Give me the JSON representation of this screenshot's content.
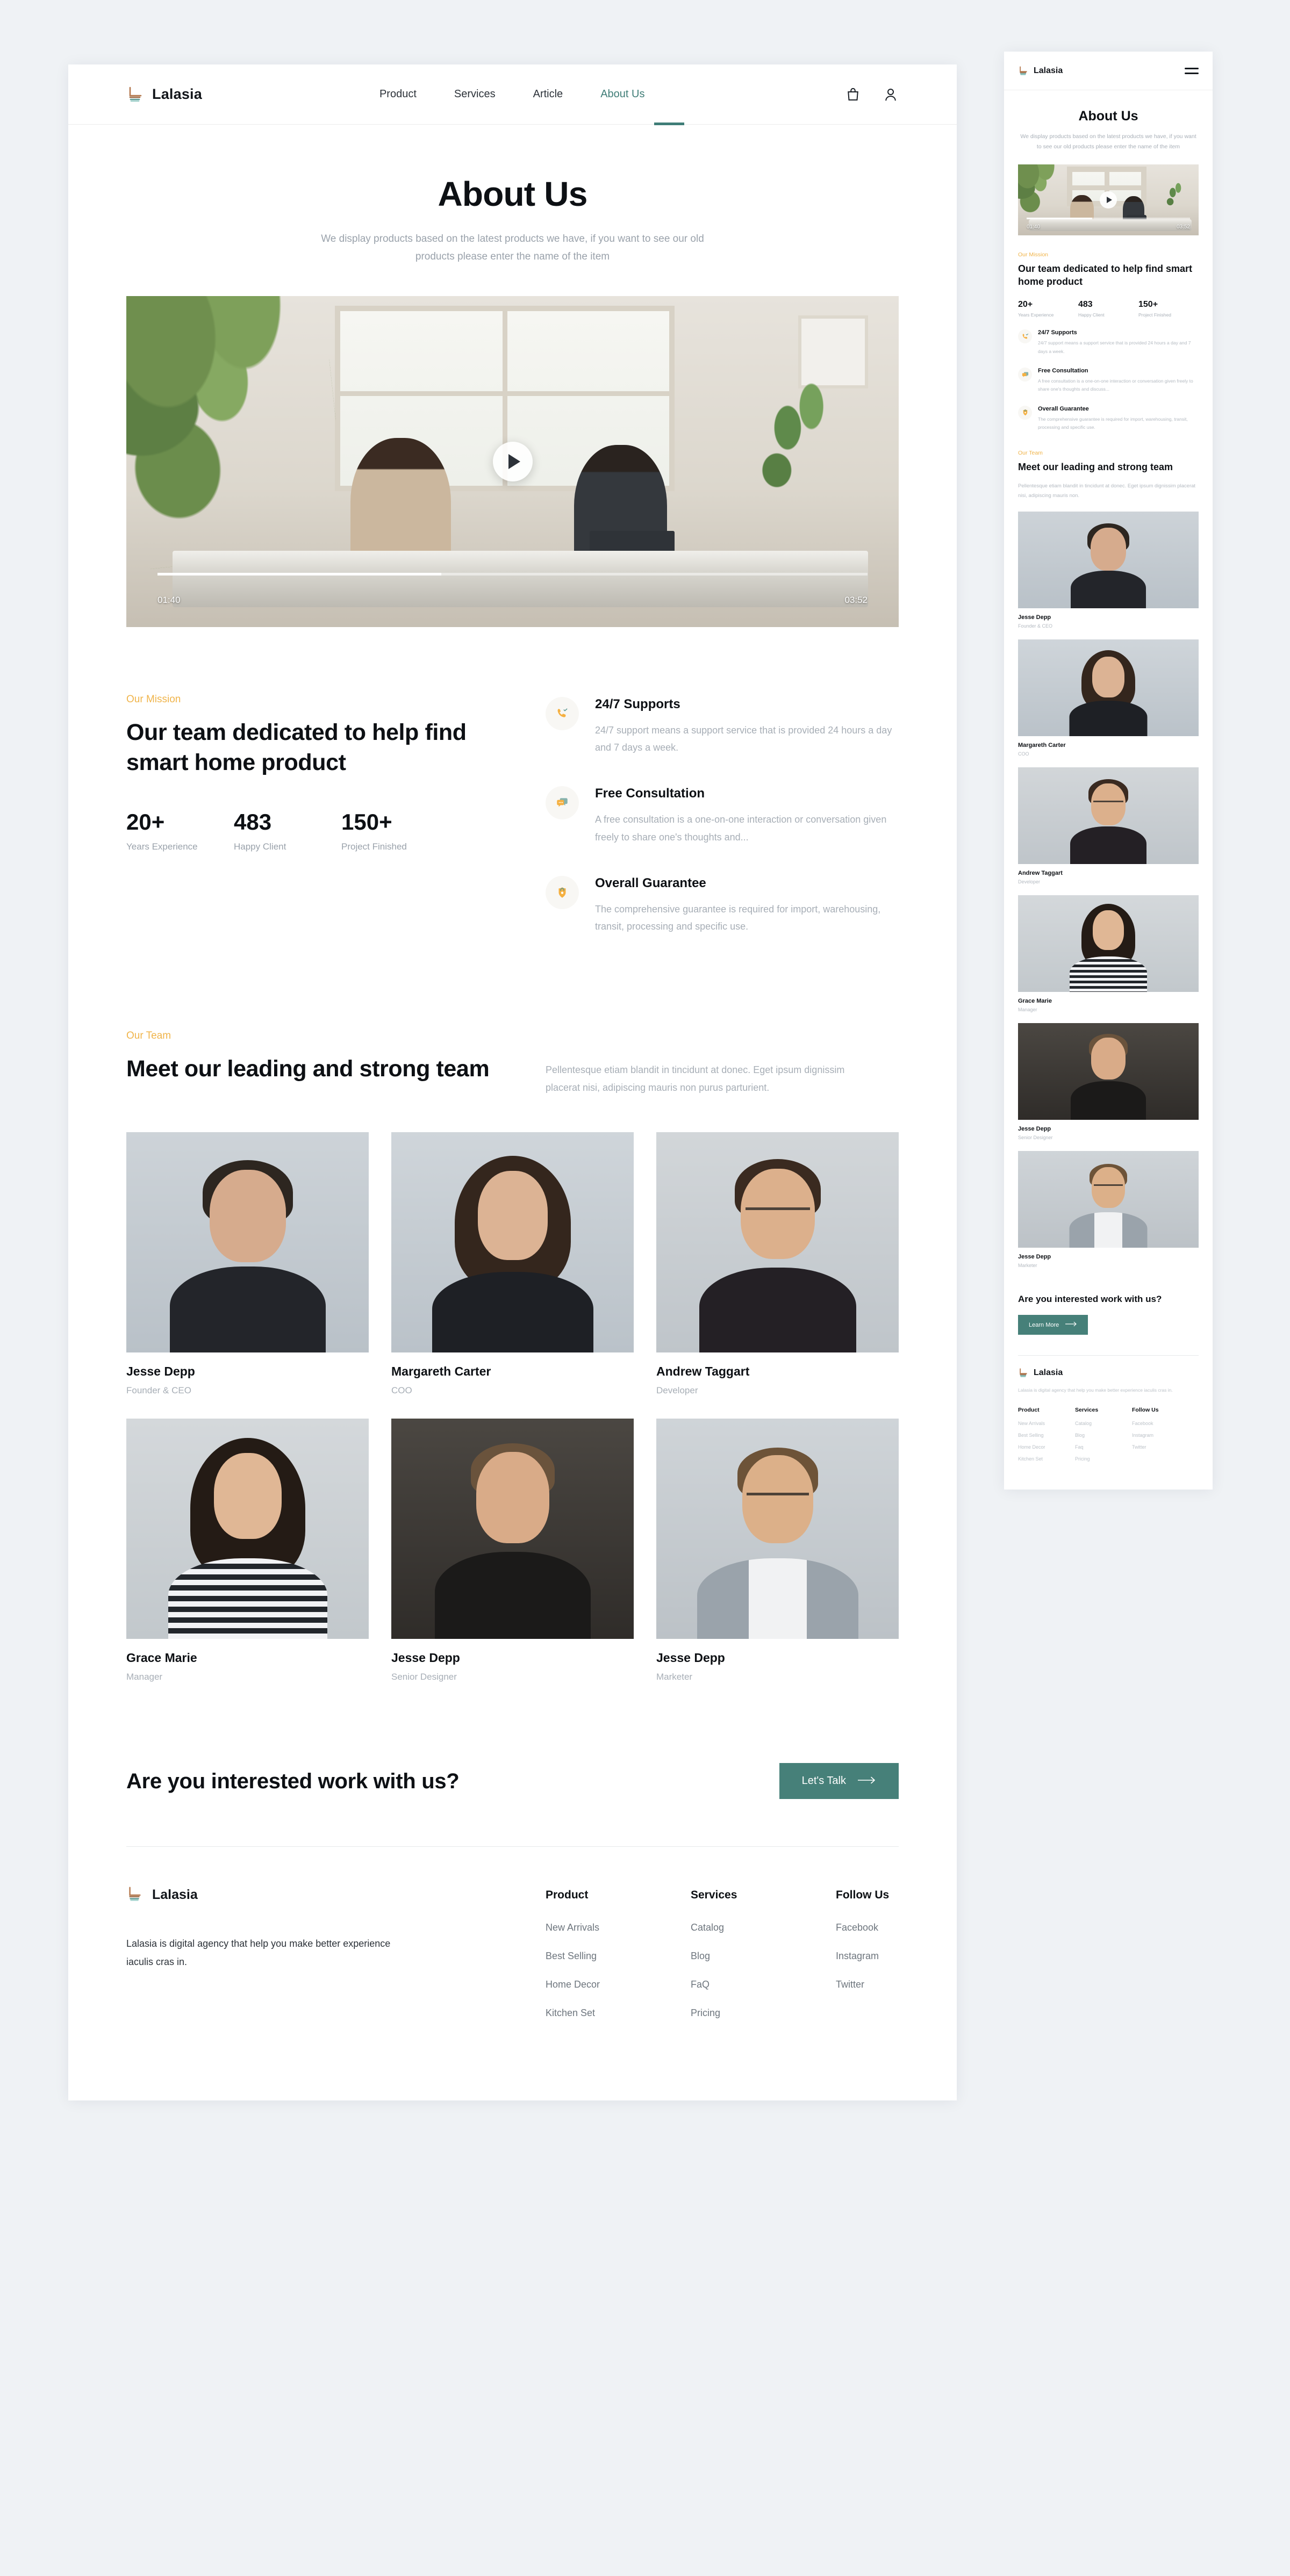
{
  "brand": {
    "name": "Lalasia",
    "logo_icon": "chair-logo-icon"
  },
  "nav": {
    "links": [
      {
        "label": "Product",
        "active": false
      },
      {
        "label": "Services",
        "active": false
      },
      {
        "label": "Article",
        "active": false
      },
      {
        "label": "About Us",
        "active": true
      }
    ],
    "icons": [
      {
        "name": "bag-icon"
      },
      {
        "name": "user-icon"
      }
    ],
    "menu_icon": "hamburger-menu-icon"
  },
  "hero": {
    "title": "About Us",
    "subtitle": "We display products based on the latest products we have, if you want to see our old products please enter the name of the item",
    "subtitle_mobile": "We display products based on the latest products we have, if you want to see our old products please enter the name of the item"
  },
  "video": {
    "play_icon": "play-icon",
    "current_time": "01:40",
    "duration": "03:52",
    "progress_percent": 40
  },
  "mission": {
    "eyebrow": "Our Mission",
    "heading": "Our team dedicated to help find  smart home product",
    "heading_mobile": "Our team dedicated to help find smart home product",
    "stats": [
      {
        "value": "20+",
        "label": "Years Experience"
      },
      {
        "value": "483",
        "label": "Happy Client"
      },
      {
        "value": "150+",
        "label": "Project Finished"
      }
    ],
    "features": [
      {
        "icon": "phone-support-icon",
        "title": "24/7 Supports",
        "desc": "24/7 support means a support service that is provided 24 hours a day and 7 days a week.",
        "desc_mobile": "24/7 support means a support service that is provided 24 hours a day and 7 days a week."
      },
      {
        "icon": "chat-bubble-icon",
        "title": "Free Consultation",
        "desc": "A free consultation is a one-on-one interaction or conversation given freely to share one's thoughts and...",
        "desc_mobile": "A free consultation is a one-on-one interaction or conversation given freely to share one's thoughts and discuss..."
      },
      {
        "icon": "shield-lock-icon",
        "title": "Overall Guarantee",
        "desc": "The comprehensive guarantee is required for import, warehousing, transit, processing and specific use.",
        "desc_mobile": "The comprehensive guarantee is required for import, warehousing, transit, processing and specific use."
      }
    ]
  },
  "team": {
    "eyebrow": "Our Team",
    "heading": "Meet our leading and strong team",
    "description": "Pellentesque etiam blandit in tincidunt at donec. Eget ipsum dignissim placerat nisi, adipiscing mauris non purus parturient.",
    "description_mobile": "Pellentesque etiam blandit in tincidunt at donec. Eget ipsum dignissim placerat nisi, adipiscing mauris non.",
    "members": [
      {
        "name": "Jesse Depp",
        "role": "Founder & CEO"
      },
      {
        "name": "Margareth Carter",
        "role": "COO"
      },
      {
        "name": "Andrew Taggart",
        "role": "Developer"
      },
      {
        "name": "Grace Marie",
        "role": "Manager"
      },
      {
        "name": "Jesse Depp",
        "role": "Senior Designer"
      },
      {
        "name": "Jesse Depp",
        "role": "Marketer"
      }
    ]
  },
  "cta": {
    "heading": "Are you interested work with us?",
    "button_label": "Let's Talk",
    "button_label_mobile": "Learn More",
    "arrow_icon": "arrow-right-icon",
    "color": "#468079"
  },
  "footer": {
    "brand": "Lalasia",
    "about": "Lalasia is digital agency that help you make better experience iaculis cras in.",
    "about_mobile": "Lalasia is digital agency that help you make better experience iaculis cras in.",
    "columns": [
      {
        "title": "Product",
        "links": [
          "New Arrivals",
          "Best Selling",
          "Home Decor",
          "Kitchen Set"
        ]
      },
      {
        "title": "Services",
        "links": [
          "Catalog",
          "Blog",
          "FaQ",
          "Pricing"
        ]
      },
      {
        "title": "Follow Us",
        "links": [
          "Facebook",
          "Instagram",
          "Twitter"
        ]
      }
    ],
    "columns_mobile": [
      {
        "title": "Product",
        "links": [
          "New Arrivals",
          "Best Selling",
          "Home Decor",
          "Kitchen Set"
        ]
      },
      {
        "title": "Services",
        "links": [
          "Catalog",
          "Blog",
          "Faq",
          "Pricing"
        ]
      },
      {
        "title": "Follow Us",
        "links": [
          "Facebook",
          "Instagram",
          "Twitter"
        ]
      }
    ]
  },
  "colors": {
    "page_background": "#eff2f5",
    "accent_teal": "#3f7d77",
    "accent_amber": "#f0b44a",
    "text_dark": "#0d1014",
    "text_muted": "#a7aeb6"
  }
}
